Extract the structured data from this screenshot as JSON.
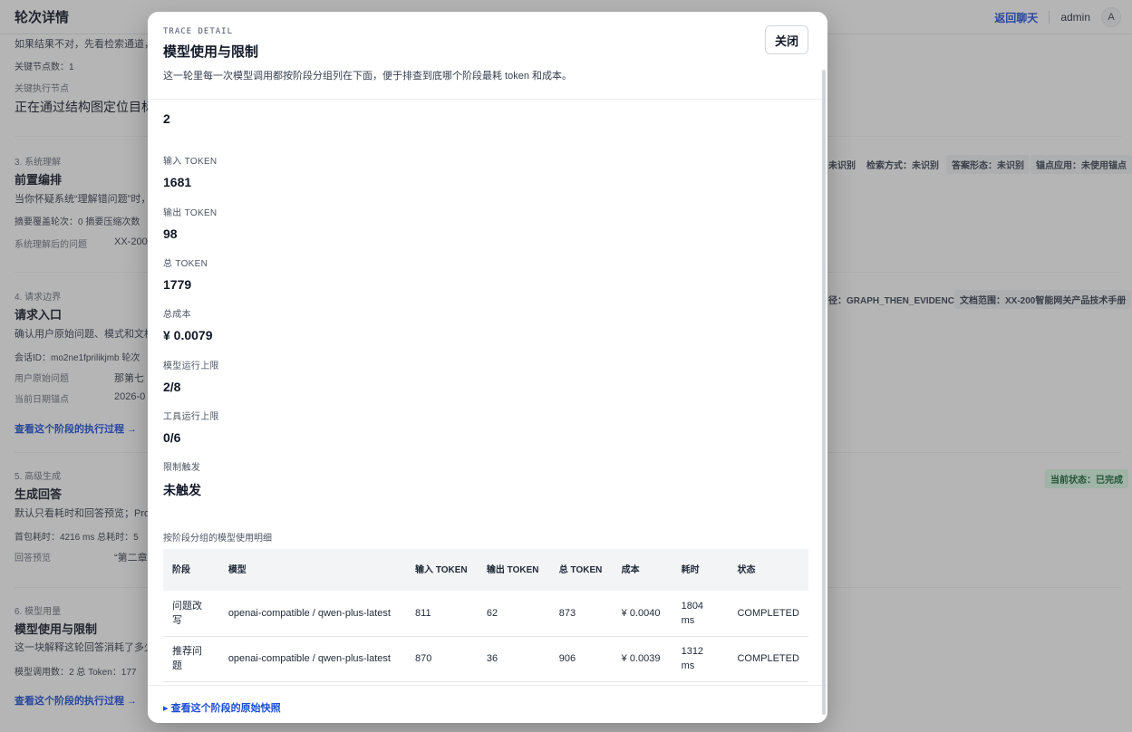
{
  "page": {
    "title": "轮次详情",
    "back_label": "返回聊天",
    "user": "admin",
    "avatar_letter": "A"
  },
  "background": {
    "hint_top": "如果结果不对，先看检索通道，",
    "key_nodes_count": "关键节点数：1",
    "key_node_label": "关键执行节点",
    "key_node_text": "正在通过结构图定位目标",
    "s3_step": "3. 系统理解",
    "s3_title": "前置编排",
    "s3_desc": "当你怀疑系统“理解错问题”时，",
    "s3_meta": "摘要覆盖轮次：0   摘要压缩次数",
    "s3_row_label": "系统理解后的问题",
    "s3_row_value": "XX-200",
    "s3_chips": [
      "未识别",
      "检索方式：未识别",
      "答案形态：未识别",
      "锚点应用：未使用锚点"
    ],
    "s4_step": "4. 请求边界",
    "s4_title": "请求入口",
    "s4_desc": "确认用户原始问题、模式和文档",
    "s4_meta": "会话ID：mo2ne1fprilikjmb   轮次",
    "s4_row1_label": "用户原始问题",
    "s4_row1_value": "那第七",
    "s4_row2_label": "当前日期锚点",
    "s4_row2_value": "2026-0",
    "s4_chips": [
      "径：GRAPH_THEN_EVIDENCE",
      "文档范围：XX-200智能网关产品技术手册"
    ],
    "s4_link": "查看这个阶段的执行过程 →",
    "s5_step": "5. 高级生成",
    "s5_title": "生成回答",
    "s5_desc": "默认只看耗时和回答预览；Pro",
    "s5_meta": "首包耗时：4216 ms   总耗时：5",
    "s5_row_label": "回答预览",
    "s5_row_value": "“第二章",
    "s5_chip": "当前状态：已完成",
    "s6_step": "6. 模型用量",
    "s6_title": "模型使用与限制",
    "s6_desc": "这一块解释这轮回答消耗了多少",
    "s6_meta": "模型调用数：2   总 Token：177",
    "s6_link": "查看这个阶段的执行过程 →"
  },
  "modal": {
    "eyebrow": "TRACE DETAIL",
    "title": "模型使用与限制",
    "description": "这一轮里每一次模型调用都按阶段分组列在下面，便于排查到底哪个阶段最耗 token 和成本。",
    "close_label": "关闭",
    "top_value": "2",
    "fields": [
      {
        "label": "输入 TOKEN",
        "value": "1681"
      },
      {
        "label": "输出 TOKEN",
        "value": "98"
      },
      {
        "label": "总 TOKEN",
        "value": "1779"
      },
      {
        "label": "总成本",
        "value": "¥ 0.0079"
      },
      {
        "label": "模型运行上限",
        "value": "2/8"
      },
      {
        "label": "工具运行上限",
        "value": "0/6"
      },
      {
        "label": "限制触发",
        "value": "未触发"
      }
    ],
    "section_label": "按阶段分组的模型使用明细",
    "table": {
      "headers": [
        "阶段",
        "模型",
        "输入 TOKEN",
        "输出 TOKEN",
        "总 TOKEN",
        "成本",
        "耗时",
        "状态"
      ],
      "rows": [
        [
          "问题改写",
          "openai-compatible / qwen-plus-latest",
          "811",
          "62",
          "873",
          "¥ 0.0040",
          "1804 ms",
          "COMPLETED"
        ],
        [
          "推荐问题",
          "openai-compatible / qwen-plus-latest",
          "870",
          "36",
          "906",
          "¥ 0.0039",
          "1312 ms",
          "COMPLETED"
        ]
      ]
    },
    "snapshot_link": "▸ 查看这个阶段的原始快照"
  }
}
